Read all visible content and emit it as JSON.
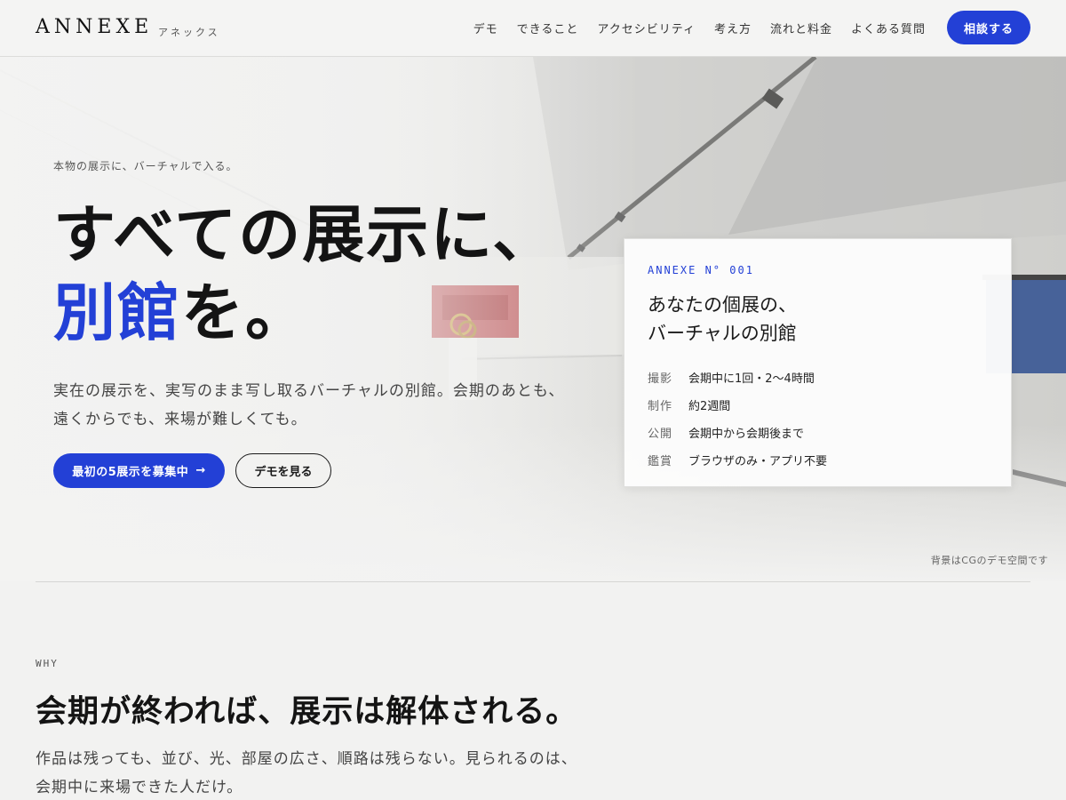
{
  "header": {
    "logo": "ANNEXE",
    "logo_kana": "アネックス",
    "nav": [
      "デモ",
      "できること",
      "アクセシビリティ",
      "考え方",
      "流れと料金",
      "よくある質問"
    ],
    "cta": "相談する"
  },
  "hero": {
    "eyebrow": "本物の展示に、バーチャルで入る。",
    "headline_line1": "すべての展示に、",
    "headline_accent": "別館",
    "headline_rest": "を。",
    "lead_line1": "実在の展示を、実写のまま写し取るバーチャルの別館。会期のあとも、",
    "lead_line2": "遠くからでも、来場が難しくても。",
    "primary_button": "最初の5展示を募集中",
    "primary_arrow": "→",
    "secondary_button": "デモを見る",
    "bg_note": "背景はCGのデモ空間です"
  },
  "card": {
    "code": "ANNEXE N° 001",
    "title_line1": "あなたの個展の、",
    "title_line2": "バーチャルの別館",
    "rows": [
      {
        "k": "撮影",
        "v": "会期中に1回・2〜4時間"
      },
      {
        "k": "制作",
        "v": "約2週間"
      },
      {
        "k": "公開",
        "v": "会期中から会期後まで"
      },
      {
        "k": "鑑賞",
        "v": "ブラウザのみ・アプリ不要"
      }
    ]
  },
  "why": {
    "label": "WHY",
    "title": "会期が終われば、展示は解体される。",
    "body_line1": "作品は残っても、並び、光、部屋の広さ、順路は残らない。見られるのは、",
    "body_line2": "会期中に来場できた人だけ。"
  },
  "colors": {
    "accent": "#2340d6",
    "background": "#f2f2f1",
    "text": "#1a1a1a"
  }
}
